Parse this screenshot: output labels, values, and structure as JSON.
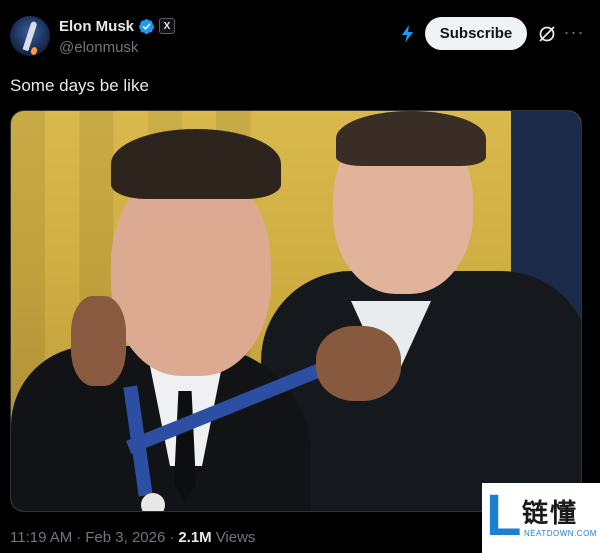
{
  "author": {
    "display_name": "Elon Musk",
    "handle": "@elonmusk",
    "verified_icon": "verified-badge-icon",
    "affiliate_badge": "X"
  },
  "header": {
    "subscribe_label": "Subscribe",
    "more_icon": "···"
  },
  "post": {
    "text": "Some days be like",
    "media_icon": "photo-image"
  },
  "meta": {
    "time": "11:19 AM",
    "sep1": "·",
    "date": "Feb 3, 2026",
    "sep2": "·",
    "views_count": "2.1M",
    "views_label": "Views"
  },
  "watermark": {
    "letter": "L",
    "chinese": "链懂",
    "domain": "NEATDOWN.COM"
  },
  "colors": {
    "background": "#000000",
    "text": "#e7e9ea",
    "muted": "#71767b",
    "verified": "#1d9bf0",
    "button_bg": "#eff3f4"
  }
}
